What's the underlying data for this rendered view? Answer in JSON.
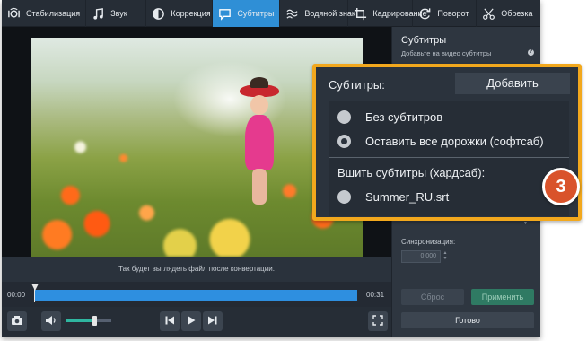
{
  "toolbar": {
    "items": [
      {
        "label": "Стабилизация",
        "icon": "stabilize-icon",
        "active": false
      },
      {
        "label": "Звук",
        "icon": "music-note-icon",
        "active": false
      },
      {
        "label": "Коррекция",
        "icon": "contrast-icon",
        "active": false
      },
      {
        "label": "Субтитры",
        "icon": "speech-bubble-icon",
        "active": true
      },
      {
        "label": "Водяной знак",
        "icon": "watermark-icon",
        "active": false
      },
      {
        "label": "Кадрирование",
        "icon": "crop-icon",
        "active": false
      },
      {
        "label": "Поворот",
        "icon": "rotate-icon",
        "active": false
      },
      {
        "label": "Обрезка",
        "icon": "scissors-icon",
        "active": false
      }
    ],
    "active_color": "#2f8fd6"
  },
  "preview": {
    "hint": "Так будет выглядеть файл после конвертации."
  },
  "timeline": {
    "start_time": "00:00",
    "end_time": "00:31",
    "track_color": "#2e8fe0"
  },
  "controls": {
    "snapshot_icon": "camera-icon",
    "volume_icon": "speaker-icon",
    "volume_level": 0.62,
    "prev_icon": "skip-previous-icon",
    "play_icon": "play-icon",
    "next_icon": "skip-next-icon",
    "fullscreen_icon": "fullscreen-icon"
  },
  "panel": {
    "title": "Субтитры",
    "subtitle": "Добавьте на видео субтитры",
    "help": "?",
    "sync_label": "Синхронизация:",
    "sync_value": "0.000",
    "reset_label": "Сброс",
    "apply_label": "Применить",
    "done_label": "Готово"
  },
  "callout": {
    "label": "Субтитры:",
    "add_label": "Добавить",
    "options": [
      {
        "label": "Без субтитров",
        "checked": false
      },
      {
        "label": "Оставить все дорожки (софтсаб)",
        "checked": true
      }
    ],
    "burn_section": "Вшить субтитры (хардсаб):",
    "burn_option": {
      "label": "Summer_RU.srt",
      "checked": false
    },
    "step": "3",
    "border_color": "#f2a81d",
    "badge_color": "#d9532b"
  }
}
